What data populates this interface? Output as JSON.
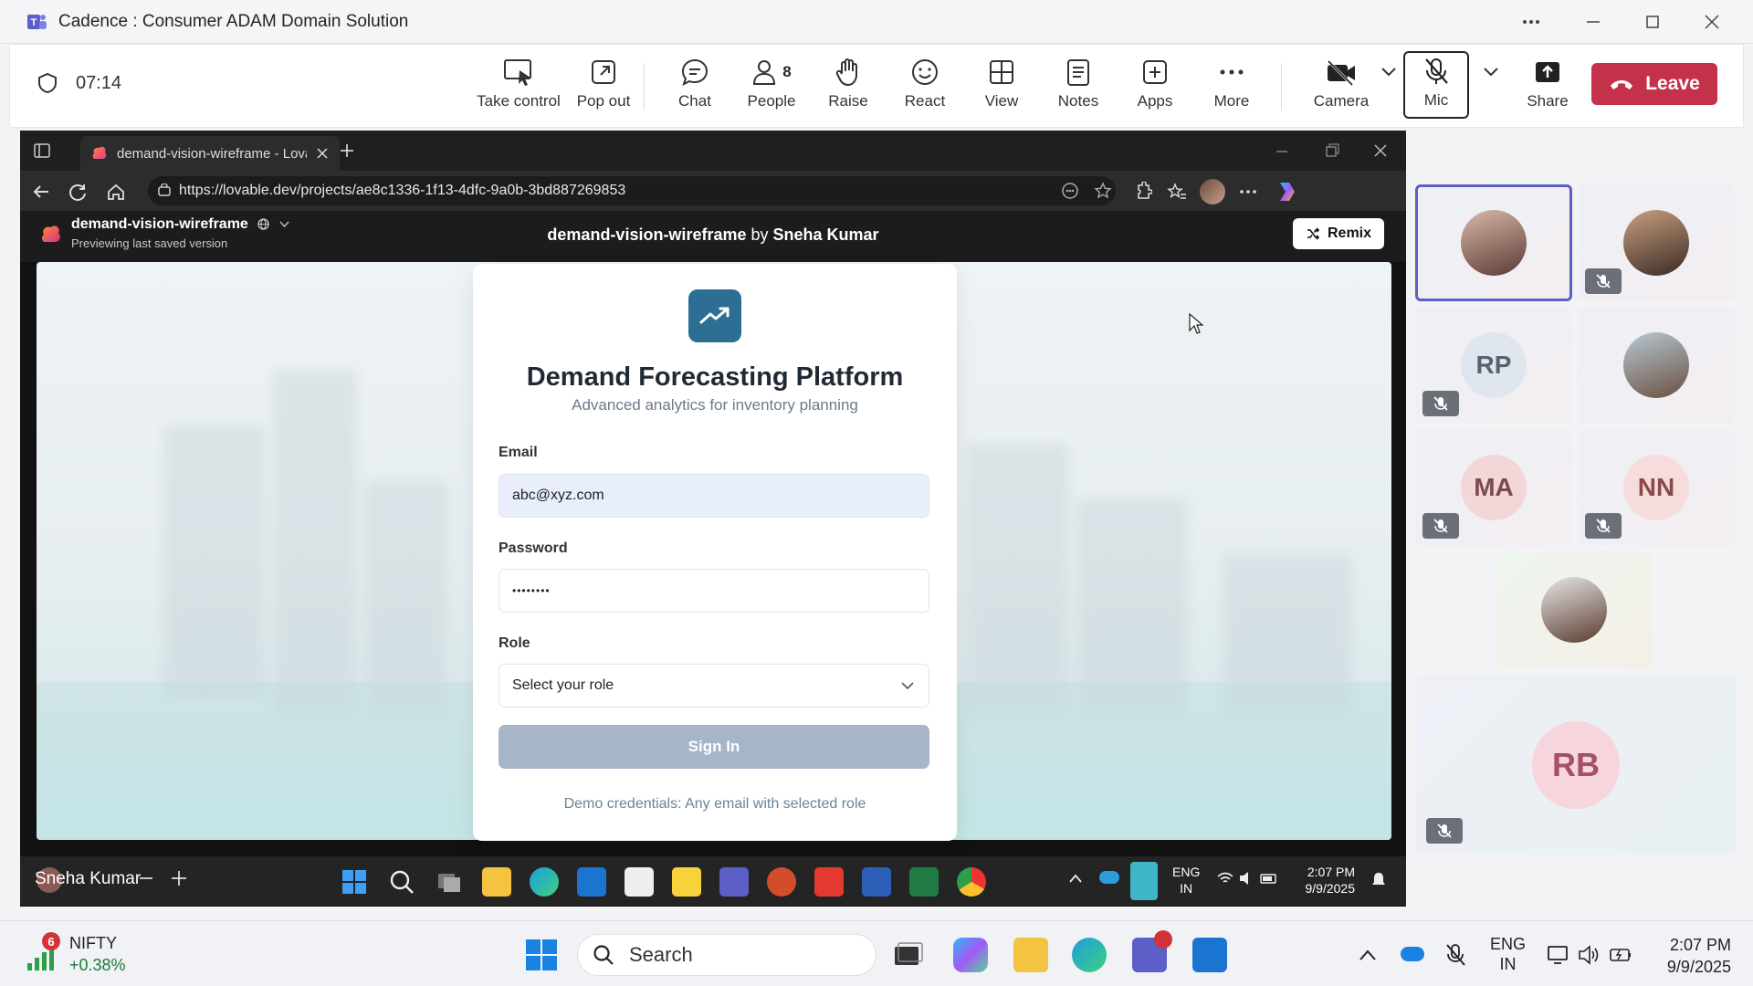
{
  "window": {
    "title": "Cadence : Consumer ADAM Domain Solution"
  },
  "meeting": {
    "timer": "07:14",
    "toolbar": {
      "take_control": "Take control",
      "pop_out": "Pop out",
      "chat": "Chat",
      "people": "People",
      "people_count": "8",
      "raise": "Raise",
      "react": "React",
      "view": "View",
      "notes": "Notes",
      "apps": "Apps",
      "more": "More",
      "camera": "Camera",
      "mic": "Mic",
      "share": "Share",
      "leave": "Leave"
    },
    "presenter": "Sneha Kumar",
    "participants": [
      {
        "initials": "",
        "type": "photo",
        "active": true
      },
      {
        "initials": "",
        "type": "photo",
        "muted": true
      },
      {
        "initials": "RP",
        "muted": true
      },
      {
        "initials": "",
        "type": "photo"
      },
      {
        "initials": "MA",
        "muted": true
      },
      {
        "initials": "NN",
        "muted": true
      },
      {
        "initials": "",
        "type": "photo"
      },
      {
        "initials": "RB",
        "muted": true
      }
    ]
  },
  "browser": {
    "tab_title": "demand-vision-wireframe - Lovab",
    "url": "https://lovable.dev/projects/ae8c1336-1f13-4dfc-9a0b-3bd887269853"
  },
  "lovable": {
    "project_name": "demand-vision-wireframe",
    "preview_note": "Previewing last saved version",
    "center_title_project": "demand-vision-wireframe",
    "center_title_by": "by",
    "center_title_author": "Sneha Kumar",
    "remix": "Remix"
  },
  "login": {
    "title": "Demand Forecasting Platform",
    "subtitle": "Advanced analytics for inventory planning",
    "email_label": "Email",
    "email_value": "abc@xyz.com",
    "password_label": "Password",
    "password_value": "••••••••",
    "role_label": "Role",
    "role_placeholder": "Select your role",
    "sign_in": "Sign In",
    "demo": "Demo credentials: Any email with selected role"
  },
  "inner_taskbar": {
    "lang": "ENG",
    "region": "IN",
    "time": "2:07 PM",
    "date": "9/9/2025"
  },
  "os_taskbar": {
    "ticker_badge": "6",
    "ticker_name": "NIFTY",
    "ticker_change": "+0.38%",
    "search": "Search",
    "lang": "ENG",
    "region": "IN",
    "time": "2:07 PM",
    "date": "9/9/2025"
  },
  "colors": {
    "leave": "#c4314b",
    "accent": "#5b5fc7",
    "login_logo": "#2d6f94",
    "signin_disabled": "#a7b5c8"
  }
}
